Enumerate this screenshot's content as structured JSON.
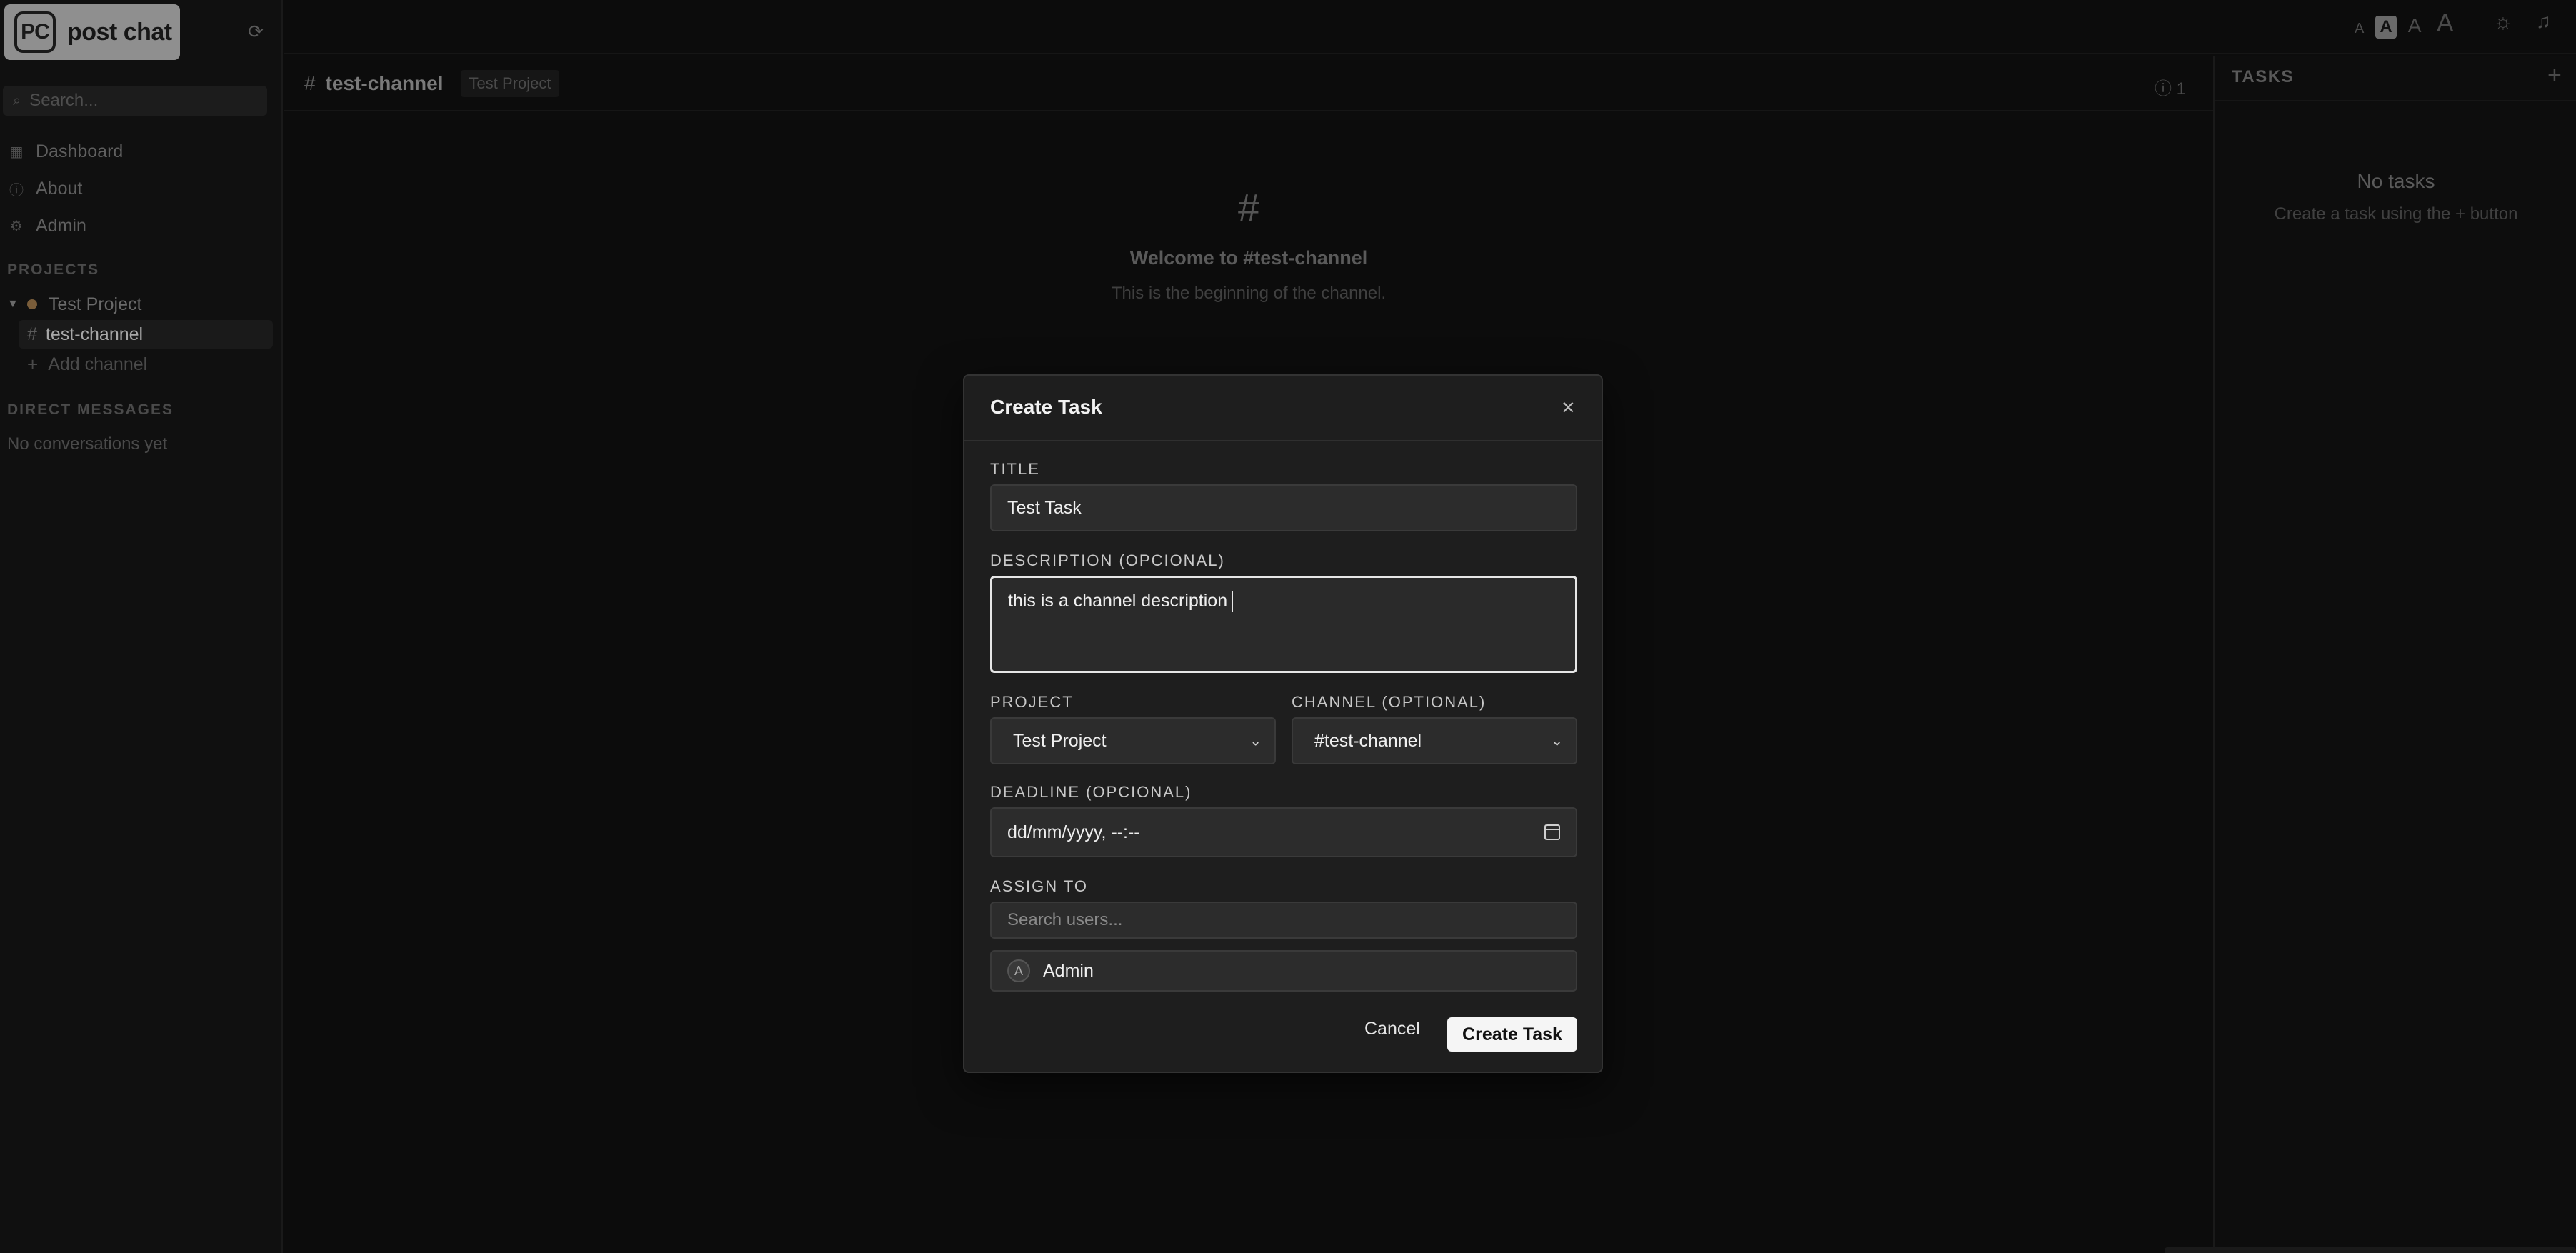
{
  "app": {
    "logo_mark": "PC",
    "logo_text": "post chat",
    "refresh_icon": "refresh-icon"
  },
  "sidebar": {
    "search_placeholder": "Search...",
    "nav": [
      {
        "label": "Dashboard",
        "icon": "grid-icon"
      },
      {
        "label": "About",
        "icon": "info-icon"
      },
      {
        "label": "Admin",
        "icon": "gear-icon"
      }
    ],
    "projects_label": "PROJECTS",
    "project_name": "Test Project",
    "project_color": "#7a5d3a",
    "active_channel": "test-channel",
    "add_channel_label": "Add channel",
    "direct_messages_label": "DIRECT MESSAGES",
    "no_conversations": "No conversations yet"
  },
  "topbar": {
    "font_sizes": [
      "A",
      "A",
      "A",
      "A"
    ],
    "selected_font_size_index": 1
  },
  "channel_header": {
    "channel_name": "test-channel",
    "project_badge": "Test Project",
    "thread_count": "1"
  },
  "welcome": {
    "title": "Welcome to #test-channel",
    "subtitle": "This is the beginning of the channel."
  },
  "tasks_panel": {
    "title": "TASKS",
    "empty_title": "No tasks",
    "empty_subtitle": "Create a task using the + button"
  },
  "modal": {
    "title": "Create Task",
    "title_label": "TITLE",
    "title_value": "Test Task",
    "description_label": "DESCRIPTION (OPCIONAL)",
    "description_value": "this is a channel description ",
    "project_label": "PROJECT",
    "project_value": "Test Project",
    "channel_label": "CHANNEL (OPTIONAL)",
    "channel_value": "#test-channel",
    "deadline_label": "DEADLINE (OPCIONAL)",
    "deadline_placeholder": "dd/mm/yyyy, --:--",
    "assign_label": "ASSIGN TO",
    "search_users_placeholder": "Search users...",
    "users": [
      {
        "initial": "A",
        "name": "Admin"
      }
    ],
    "cancel_label": "Cancel",
    "create_label": "Create Task"
  }
}
